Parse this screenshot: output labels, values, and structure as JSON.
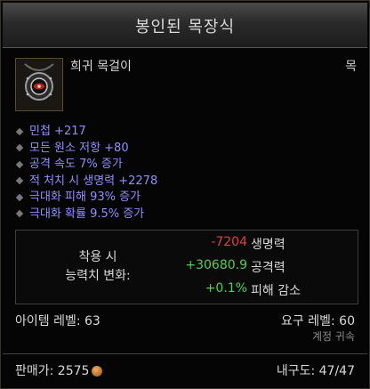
{
  "title": "봉인된 목장식",
  "item": {
    "type": "희귀 목걸이",
    "slot": "목",
    "icon": "amulet-icon"
  },
  "affixes": [
    "민첩 +217",
    "모든 원소 저항 +80",
    "공격 속도 7% 증가",
    "적 처치 시 생명력 +2278",
    "극대화 피해 93% 증가",
    "극대화 확률 9.5% 증가"
  ],
  "comparison": {
    "label_line1": "착용 시",
    "label_line2": "능력치 변화:",
    "rows": [
      {
        "delta": "-7204",
        "stat": "생명력",
        "sign": "negative"
      },
      {
        "delta": "+30680.9",
        "stat": "공격력",
        "sign": "positive"
      },
      {
        "delta": "+0.1%",
        "stat": "피해 감소",
        "sign": "positive"
      }
    ]
  },
  "item_level": "아이템 레벨: 63",
  "required_level": "요구 레벨: 60",
  "account_bound": "계정 귀속",
  "sell_price": "판매가: 2575",
  "durability": "내구도: 47/47",
  "colors": {
    "affix": "#8f8fff",
    "negative": "#e04040",
    "positive": "#50d050",
    "title_bar": "#2a2a2a"
  }
}
